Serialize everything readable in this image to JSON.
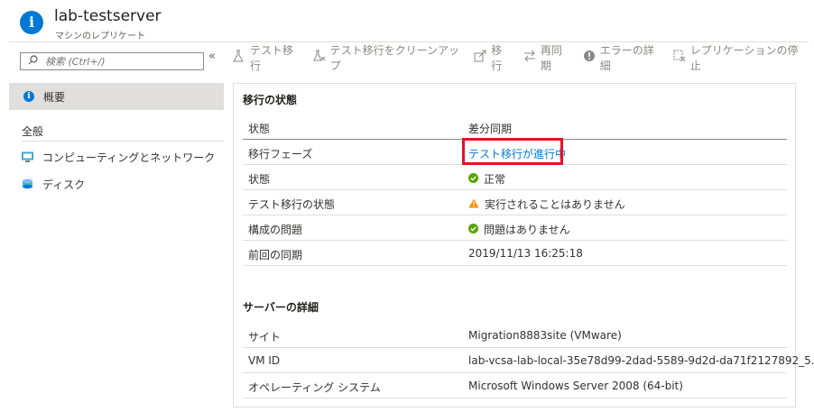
{
  "header": {
    "title": "lab-testserver",
    "subtitle": "マシンのレプリケート",
    "icon": "info-icon"
  },
  "sidebar": {
    "search_placeholder": "検索 (Ctrl+/)",
    "collapse_glyph": "«",
    "overview_label": "概要",
    "section_label": "全般",
    "items": [
      {
        "label": "コンピューティングとネットワーク",
        "icon": "compute-network-icon"
      },
      {
        "label": "ディスク",
        "icon": "disk-icon"
      }
    ]
  },
  "toolbar": {
    "test_migrate": "テスト移行",
    "cleanup_test": "テスト移行をクリーンアップ",
    "migrate": "移行",
    "resync": "再同期",
    "error_details": "エラーの詳細",
    "stop_replication": "レプリケーションの停止"
  },
  "migration": {
    "title": "移行の状態",
    "header_key": "状態",
    "header_value": "差分同期",
    "rows": [
      {
        "key": "移行フェーズ",
        "value": "テスト移行が進行中"
      },
      {
        "key": "状態",
        "value": "正常"
      },
      {
        "key": "テスト移行の状態",
        "value": "実行されることはありません"
      },
      {
        "key": "構成の問題",
        "value": "問題はありません"
      },
      {
        "key": "前回の同期",
        "value": "2019/11/13 16:25:18"
      }
    ]
  },
  "server": {
    "title": "サーバーの詳細",
    "rows": [
      {
        "key": "サイト",
        "value": "Migration8883site (VMware)"
      },
      {
        "key": "VM ID",
        "value": "lab-vcsa-lab-local-35e78d99-2dad-5589-9d2d-da71f2127892_5..."
      },
      {
        "key": "オペレーティング システム",
        "value": "Microsoft Windows Server 2008 (64-bit)"
      }
    ]
  },
  "colors": {
    "accent": "#0078d4",
    "success": "#57a300",
    "warning": "#ff8c00",
    "highlight": "#e81123"
  }
}
